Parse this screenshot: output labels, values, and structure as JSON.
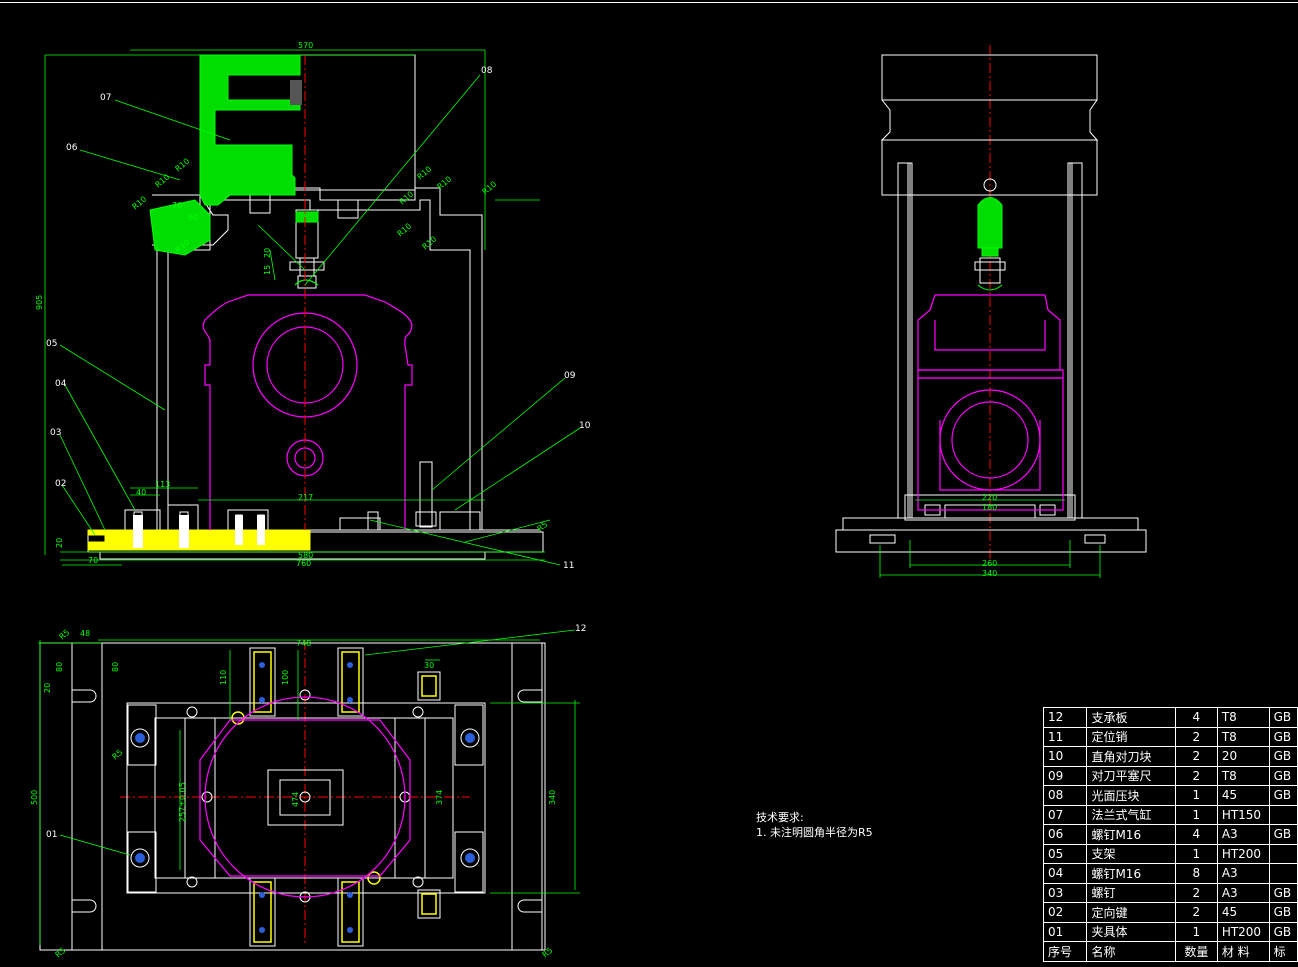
{
  "front_view": {
    "balloons": [
      "07",
      "06",
      "05",
      "04",
      "03",
      "02",
      "08",
      "09",
      "10",
      "11"
    ],
    "dims": {
      "top_width": "570",
      "height": "905",
      "r10": "R10",
      "d70": "70",
      "d60": "60",
      "d20": "20",
      "d15": "15",
      "d40": "40",
      "d113": "113",
      "d217": "217",
      "d580": "580",
      "d760": "760",
      "d20b": "20",
      "d70b": "70",
      "r5": "R5"
    }
  },
  "side_view": {
    "dims": {
      "d220": "220",
      "d180": "180",
      "d260": "260",
      "d340": "340"
    }
  },
  "top_view": {
    "balloons": [
      "12",
      "01"
    ],
    "dims": {
      "d48": "48",
      "d80": "80",
      "d20": "20",
      "d748": "748",
      "d110": "110",
      "d100": "100",
      "d30": "30",
      "d500": "500",
      "d374": "374",
      "d340": "340",
      "d474": "474",
      "d257": "257±0.05",
      "r5": "R5"
    }
  },
  "notes": {
    "heading": "技术要求:",
    "item1": "1. 未注明圆角半径为R5"
  },
  "bom": {
    "rows": [
      {
        "no": "12",
        "name": "支承板",
        "qty": "4",
        "mat": "T8",
        "std": "GB"
      },
      {
        "no": "11",
        "name": "定位销",
        "qty": "2",
        "mat": "T8",
        "std": "GB"
      },
      {
        "no": "10",
        "name": "直角对刀块",
        "qty": "2",
        "mat": "20",
        "std": "GB"
      },
      {
        "no": "09",
        "name": "对刀平塞尺",
        "qty": "2",
        "mat": "T8",
        "std": "GB"
      },
      {
        "no": "08",
        "name": "光面压块",
        "qty": "1",
        "mat": "45",
        "std": "GB"
      },
      {
        "no": "07",
        "name": "法兰式气缸",
        "qty": "1",
        "mat": "HT150",
        "std": ""
      },
      {
        "no": "06",
        "name": "螺钉M16",
        "qty": "4",
        "mat": "A3",
        "std": "GB"
      },
      {
        "no": "05",
        "name": "支架",
        "qty": "1",
        "mat": "HT200",
        "std": ""
      },
      {
        "no": "04",
        "name": "螺钉M16",
        "qty": "8",
        "mat": "A3",
        "std": ""
      },
      {
        "no": "03",
        "name": "螺钉",
        "qty": "2",
        "mat": "A3",
        "std": "GB"
      },
      {
        "no": "02",
        "name": "定向键",
        "qty": "2",
        "mat": "45",
        "std": "GB"
      },
      {
        "no": "01",
        "name": "夹具体",
        "qty": "1",
        "mat": "HT200",
        "std": "GB"
      }
    ],
    "header": {
      "no": "序号",
      "name": "名称",
      "qty": "数量",
      "mat": "材 料",
      "std": "标"
    }
  },
  "colors": {
    "background": "#000000",
    "outline": "#ffffff",
    "dimension": "#00ff00",
    "workpiece": "#ff00ff",
    "center": "#ff0000",
    "highlight_green": "#00dd00",
    "highlight_yellow": "#ffff00"
  }
}
